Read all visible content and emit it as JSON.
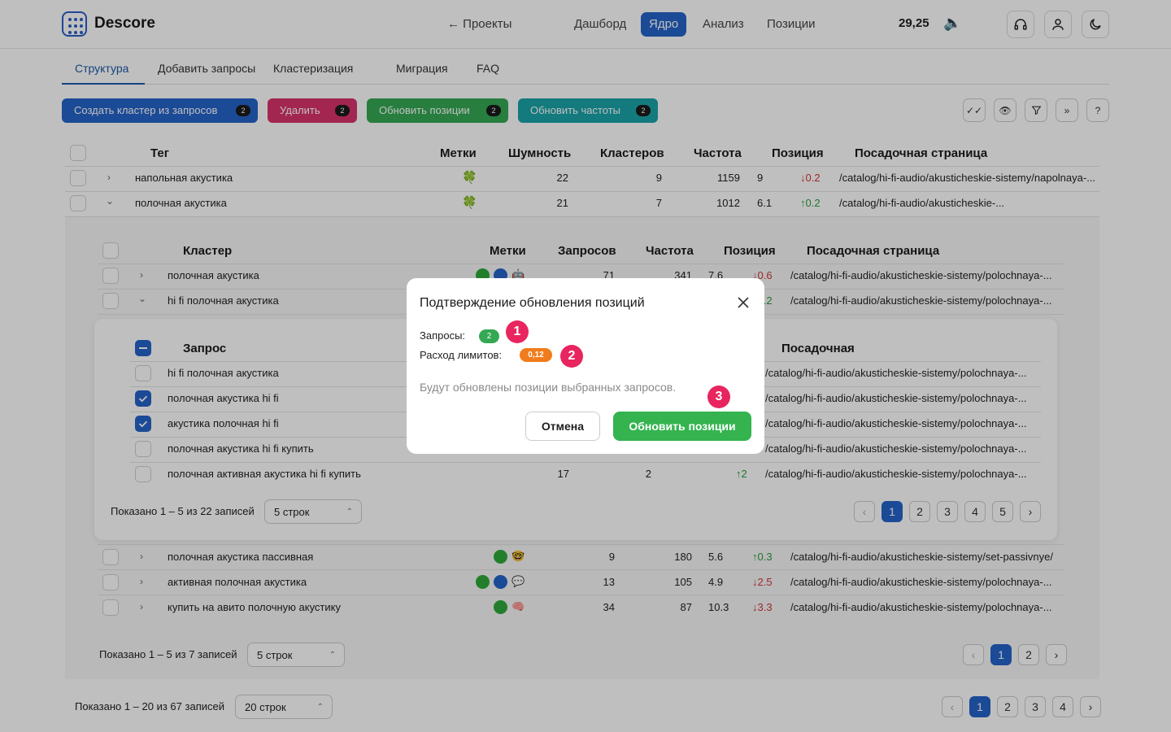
{
  "header": {
    "brand": "Descore",
    "back": "← Проекты",
    "nav": [
      "Дашборд",
      "Ядро",
      "Анализ",
      "Позиции"
    ],
    "active_nav": "Ядро",
    "balance": "29,25",
    "balance_icon": "speaker-icon"
  },
  "tabs": [
    "Структура",
    "Добавить запросы",
    "Кластеризация",
    "Миграция",
    "FAQ"
  ],
  "actions": {
    "create": {
      "label": "Создать кластер из запросов",
      "count": "2",
      "color": "#2563c9"
    },
    "delete": {
      "label": "Удалить",
      "count": "2",
      "color": "#d9336b"
    },
    "update_pos": {
      "label": "Обновить позиции",
      "count": "2",
      "color": "#34a853"
    },
    "update_freq": {
      "label": "Обновить частоты",
      "count": "2",
      "color": "#1aa3a8"
    }
  },
  "tag_table": {
    "headers": [
      "Тег",
      "Метки",
      "Шумность",
      "Кластеров",
      "Частота",
      "Позиция",
      "Посадочная страница"
    ],
    "rows": [
      {
        "name": "напольная акустика",
        "mark": "🍀",
        "noise": "22",
        "clusters": "9",
        "freq": "1159",
        "pos": "9",
        "delta": "↓0.2",
        "dir": "down",
        "url": "/catalog/hi-fi-audio/akusticheskie-sistemy/napolnaya-..."
      },
      {
        "name": "полочная акустика",
        "mark": "🍀",
        "noise": "21",
        "clusters": "7",
        "freq": "1012",
        "pos": "6.1",
        "delta": "↑0.2",
        "dir": "up",
        "url": "/catalog/hi-fi-audio/akusticheskie-..."
      }
    ]
  },
  "cluster_table": {
    "headers": [
      "Кластер",
      "Метки",
      "Запросов",
      "Частота",
      "Позиция",
      "Посадочная страница"
    ],
    "rows": [
      {
        "name": "полочная акустика",
        "queries": "71",
        "freq": "341",
        "pos": "7.6",
        "delta": "↓0.6",
        "dir": "down",
        "url": "/catalog/hi-fi-audio/akusticheskie-sistemy/polochnaya-..."
      },
      {
        "name": "hi fi полочная акустика",
        "queries": "",
        "freq": "",
        "pos": "",
        "delta": "↑0.2",
        "dir": "up",
        "url": "/catalog/hi-fi-audio/akusticheskie-sistemy/polochnaya-..."
      }
    ],
    "rows_after": [
      {
        "name": "полочная акустика пассивная",
        "queries": "9",
        "freq": "180",
        "pos": "5.6",
        "delta": "↑0.3",
        "dir": "up",
        "url": "/catalog/hi-fi-audio/akusticheskie-sistemy/set-passivnye/"
      },
      {
        "name": "активная полочная акустика",
        "queries": "13",
        "freq": "105",
        "pos": "4.9",
        "delta": "↓2.5",
        "dir": "down",
        "url": "/catalog/hi-fi-audio/akusticheskie-sistemy/polochnaya-..."
      },
      {
        "name": "купить на авито полочную акустику",
        "queries": "34",
        "freq": "87",
        "pos": "10.3",
        "delta": "↓3.3",
        "dir": "down",
        "url": "/catalog/hi-fi-audio/akusticheskie-sistemy/polochnaya-..."
      }
    ],
    "footer": "Показано 1 – 5 из 7 записей",
    "rows_select": "5 строк",
    "pages": [
      "1",
      "2"
    ]
  },
  "query_table": {
    "headers": [
      "Запрос",
      "Посадочная"
    ],
    "rows": [
      {
        "name": "hi fi полочная акустика",
        "checked": false,
        "url": "/catalog/hi-fi-audio/akusticheskie-sistemy/polochnaya-..."
      },
      {
        "name": "полочная акустика hi fi",
        "checked": true,
        "url": "/catalog/hi-fi-audio/akusticheskie-sistemy/polochnaya-..."
      },
      {
        "name": "акустика полочная hi fi",
        "checked": true,
        "url": "/catalog/hi-fi-audio/akusticheskie-sistemy/polochnaya-..."
      },
      {
        "name": "полочная акустика hi fi купить",
        "checked": false,
        "url": "/catalog/hi-fi-audio/akusticheskie-sistemy/polochnaya-..."
      },
      {
        "name": "полочная активная акустика hi fi купить",
        "checked": false,
        "freq": "17",
        "pos": "2",
        "delta": "↑2",
        "url": "/catalog/hi-fi-audio/akusticheskie-sistemy/polochnaya-..."
      }
    ],
    "footer": "Показано 1 – 5 из 22 записей",
    "rows_select": "5 строк",
    "pages": [
      "1",
      "2",
      "3",
      "4",
      "5"
    ]
  },
  "page_footer": {
    "text": "Показано 1 – 20 из 67 записей",
    "rows_select": "20 строк",
    "pages": [
      "1",
      "2",
      "3",
      "4"
    ]
  },
  "modal": {
    "title": "Подтверждение обновления позиций",
    "queries_label": "Запросы:",
    "queries_count": "2",
    "limits_label": "Расход лимитов:",
    "limits_value": "0,12",
    "note": "Будут обновлены позиции выбранных запросов.",
    "cancel": "Отмена",
    "confirm": "Обновить позиции",
    "markers": [
      "1",
      "2",
      "3"
    ]
  }
}
